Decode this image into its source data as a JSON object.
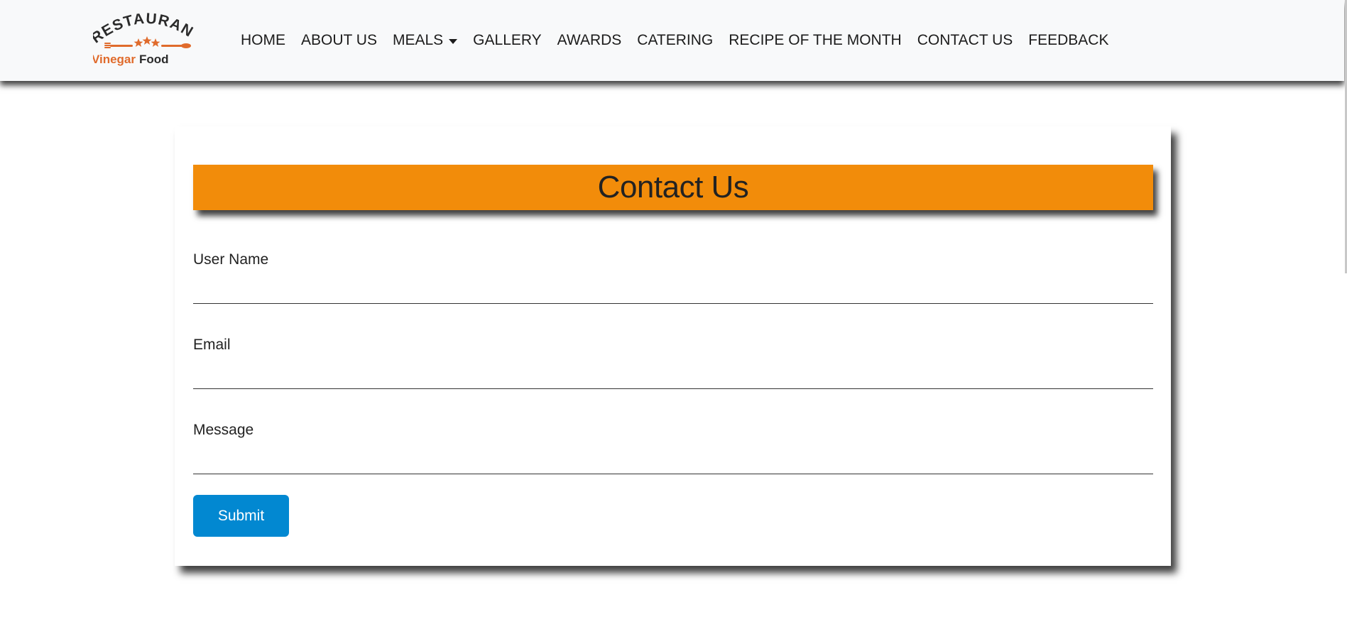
{
  "navbar": {
    "logo": {
      "top_text": "RESTAURANT",
      "brand_primary": "Vinegar",
      "brand_secondary": "Food",
      "accent_color": "#e06b2c",
      "dark_color": "#2b2b2b",
      "icons": [
        "fork-icon",
        "knife-icon",
        "star-icon"
      ]
    },
    "items": [
      {
        "label": "HOME"
      },
      {
        "label": "ABOUT US"
      },
      {
        "label": "MEALS",
        "has_dropdown": true,
        "icon": "caret-down-icon"
      },
      {
        "label": "GALLERY"
      },
      {
        "label": "AWARDS"
      },
      {
        "label": "CATERING"
      },
      {
        "label": "RECIPE OF THE MONTH"
      },
      {
        "label": "CONTACT US"
      },
      {
        "label": "FEEDBACK"
      }
    ]
  },
  "contact_form": {
    "title": "Contact Us",
    "header_color": "#f28c0a",
    "fields": [
      {
        "label": "User Name",
        "value": "",
        "placeholder": ""
      },
      {
        "label": "Email",
        "value": "",
        "placeholder": ""
      },
      {
        "label": "Message",
        "value": "",
        "placeholder": ""
      }
    ],
    "submit_label": "Submit",
    "submit_color": "#0288d1"
  }
}
